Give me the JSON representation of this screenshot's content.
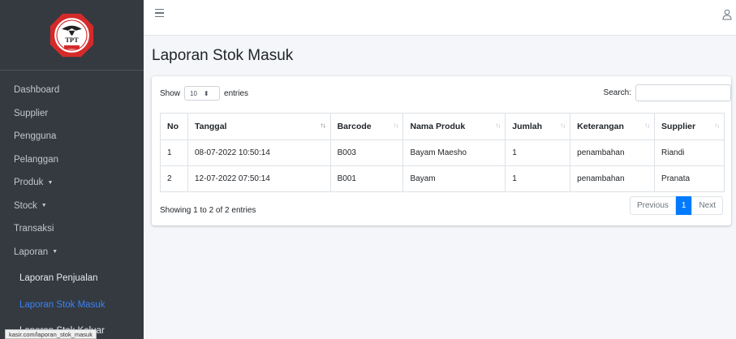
{
  "sidebar": {
    "logo_text": "TPT",
    "items": [
      {
        "label": "Dashboard"
      },
      {
        "label": "Supplier"
      },
      {
        "label": "Pengguna"
      },
      {
        "label": "Pelanggan"
      },
      {
        "label": "Produk",
        "caret": "▼"
      },
      {
        "label": "Stock",
        "caret": "▼"
      },
      {
        "label": "Transaksi"
      },
      {
        "label": "Laporan",
        "caret": "▼"
      }
    ],
    "subitems": [
      {
        "label": "Laporan Penjualan"
      },
      {
        "label": "Laporan Stok Masuk"
      },
      {
        "label": "Laporan Stok Keluar"
      }
    ]
  },
  "status_url": "kasir.com/laporan_stok_masuk",
  "page": {
    "title": "Laporan Stok Masuk"
  },
  "table_controls": {
    "show_label": "Show",
    "length_value": "10",
    "entries_label": "entries",
    "search_label": "Search:"
  },
  "table": {
    "headers": [
      "No",
      "Tanggal",
      "Barcode",
      "Nama Produk",
      "Jumlah",
      "Keterangan",
      "Supplier"
    ],
    "rows": [
      [
        "1",
        "08-07-2022 10:50:14",
        "B003",
        "Bayam Maesho",
        "1",
        "penambahan",
        "Riandi"
      ],
      [
        "2",
        "12-07-2022 07:50:14",
        "B001",
        "Bayam",
        "1",
        "penambahan",
        "Pranata"
      ]
    ]
  },
  "footer": {
    "info": "Showing 1 to 2 of 2 entries",
    "previous": "Previous",
    "page": "1",
    "next": "Next"
  },
  "colors": {
    "sidebar_bg": "#343a40",
    "active": "#3b82f6",
    "primary": "#007bff",
    "logo_red": "#d42a2a"
  }
}
